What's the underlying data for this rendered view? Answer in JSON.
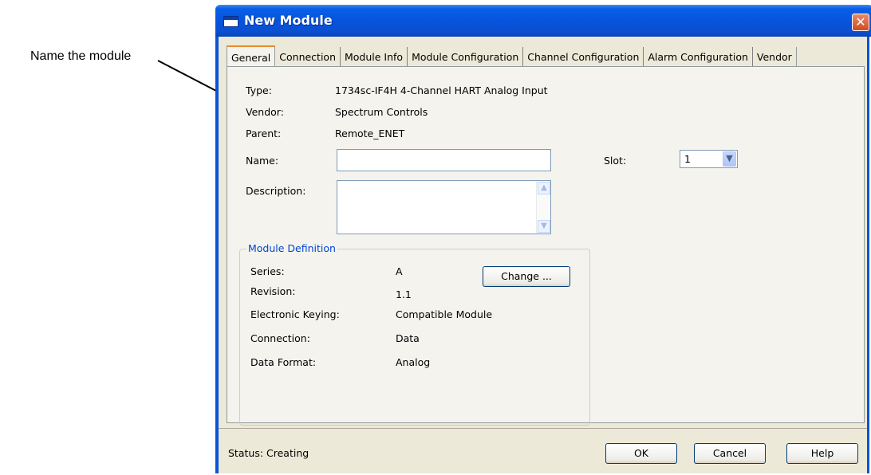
{
  "annotation": {
    "label": "Name the module"
  },
  "window": {
    "title": "New Module",
    "close_glyph": "✕"
  },
  "tabs": [
    {
      "label": "General",
      "active": true
    },
    {
      "label": "Connection",
      "active": false
    },
    {
      "label": "Module Info",
      "active": false
    },
    {
      "label": "Module Configuration",
      "active": false
    },
    {
      "label": "Channel Configuration",
      "active": false
    },
    {
      "label": "Alarm Configuration",
      "active": false
    },
    {
      "label": "Vendor",
      "active": false
    }
  ],
  "general": {
    "type_label": "Type:",
    "type_value": "1734sc-IF4H 4-Channel HART Analog Input",
    "vendor_label": "Vendor:",
    "vendor_value": "Spectrum Controls",
    "parent_label": "Parent:",
    "parent_value": "Remote_ENET",
    "name_label": "Name:",
    "name_value": "",
    "description_label": "Description:",
    "description_value": "",
    "slot_label": "Slot:",
    "slot_value": "1"
  },
  "module_definition": {
    "title": "Module Definition",
    "series_label": "Series:",
    "series_value": "A",
    "revision_label": "Revision:",
    "revision_value": "1.1",
    "keying_label": "Electronic Keying:",
    "keying_value": "Compatible Module",
    "connection_label": "Connection:",
    "connection_value": "Data",
    "format_label": "Data Format:",
    "format_value": "Analog",
    "change_button": "Change ..."
  },
  "footer": {
    "status": "Status:  Creating",
    "ok": "OK",
    "cancel": "Cancel",
    "help": "Help"
  },
  "colors": {
    "title_bar": "#0654de",
    "dialog_face": "#ece9d8",
    "group_title": "#0046d5",
    "close_button": "#d24a21"
  }
}
